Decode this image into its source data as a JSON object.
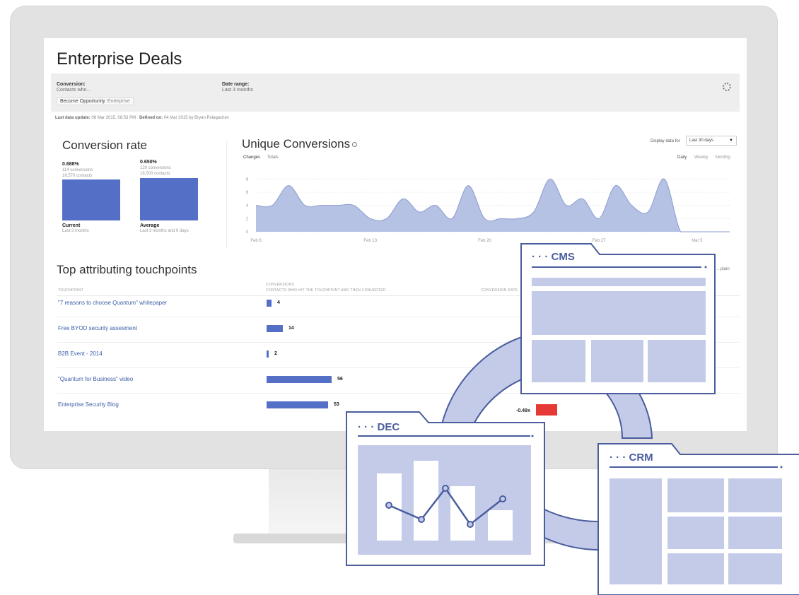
{
  "page": {
    "title": "Enterprise Deals"
  },
  "filter": {
    "conversion_label": "Conversion:",
    "conversion_sub": "Contacts who...",
    "chip_text": "Become Opportunity",
    "chip_sub": "Enterprise",
    "date_label": "Date range:",
    "date_value": "Last 3 months",
    "meta_update_label": "Last data update:",
    "meta_update_value": "08 Mar 2015, 08:53 PM",
    "meta_defined_label": "Defined on:",
    "meta_defined_value": "04 Mar 2015 by Bryan Polagachev",
    "settings_icon": "gear-icon"
  },
  "conversion_rate": {
    "title": "Conversion rate",
    "current": {
      "pct": "0.688%",
      "sub1": "114 conversions",
      "sub2": "16,570 contacts",
      "label": "Current",
      "label_sub": "Last 3 months",
      "bar_level": 0.9
    },
    "average": {
      "pct": "0.650%",
      "sub1": "120 conversions",
      "sub2": "18,500 contacts",
      "label": "Average",
      "label_sub": "Last 3 months and 9 days",
      "bar_level": 0.94
    },
    "bar_color": "#5470c6"
  },
  "unique_conversions": {
    "title": "Unique Conversions",
    "tabs": [
      "Changes",
      "Totals"
    ],
    "display_label": "Display data for",
    "display_value": "Last 30 days",
    "granularity": [
      "Daily",
      "Weekly",
      "Monthly"
    ]
  },
  "chart_data": {
    "type": "area",
    "x": [
      "Feb 6",
      "Feb 7",
      "Feb 8",
      "Feb 9",
      "Feb 10",
      "Feb 11",
      "Feb 12",
      "Feb 13",
      "Feb 14",
      "Feb 15",
      "Feb 16",
      "Feb 17",
      "Feb 18",
      "Feb 19",
      "Feb 20",
      "Feb 21",
      "Feb 22",
      "Feb 23",
      "Feb 24",
      "Feb 25",
      "Feb 26",
      "Feb 27",
      "Feb 28",
      "Mar 1",
      "Mar 2",
      "Mar 3",
      "Mar 4",
      "Mar 5",
      "Mar 6",
      "Mar 7"
    ],
    "series": [
      {
        "values": [
          4,
          4,
          7,
          4,
          4,
          4,
          4,
          2,
          2,
          5,
          3,
          4,
          2,
          7,
          2,
          2,
          2,
          3,
          8,
          4,
          5,
          2,
          7,
          4,
          3,
          8,
          0,
          0,
          0,
          0
        ]
      }
    ],
    "x_tick_labels": [
      "Feb 6",
      "Feb 13",
      "Feb 20",
      "Feb 27",
      "Mar 5"
    ],
    "y_ticks": [
      0,
      2,
      4,
      6,
      8
    ],
    "ylim": [
      0,
      9
    ],
    "fill_color": "#b6c2e4",
    "line_color": "#8a9bd0"
  },
  "touchpoints": {
    "title": "Top attributing touchpoints",
    "columns": [
      "TOUCHPOINT",
      "CONVERSIONS",
      "CONTACTS WHO HIT THE TOUCHPOINT AND THEN CONVERTED",
      "CONVERSION RATE"
    ],
    "corner_label": "...plain",
    "rows": [
      {
        "name": "\"7 reasons to choose Quantum\" whitepaper",
        "value": "4"
      },
      {
        "name": "Free BYOD security assesment",
        "value": "14"
      },
      {
        "name": "B2B Event - 2014",
        "value": "2"
      },
      {
        "name": "\"Quantum for Business\" video",
        "value": "56"
      },
      {
        "name": "Enterprise Security Blog",
        "value": "53"
      }
    ],
    "max_value": 56,
    "bar_color": "#5470c6"
  },
  "illustration": {
    "cms_label": "· · · CMS",
    "dec_label": "· · · DEC",
    "crm_label": "· · · CRM",
    "rate_label": "-0.49x",
    "panel_fill": "#c3cbe9",
    "stroke": "#4a5d9e",
    "accent_red": "#e53935"
  }
}
